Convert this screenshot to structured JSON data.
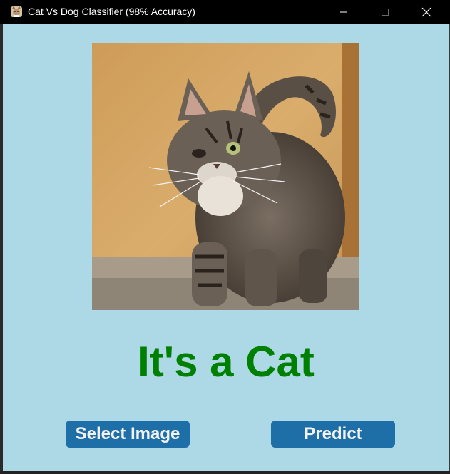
{
  "window": {
    "title": "Cat Vs Dog Classifier (98% Accuracy)",
    "app_icon": "cat-app-icon",
    "controls": [
      "minimize-icon",
      "maximize-icon",
      "close-icon"
    ]
  },
  "main": {
    "image_alt": "cat-photo",
    "result_text": "It's a Cat",
    "result_color": "#008000",
    "background_color": "#add8e6"
  },
  "buttons": {
    "select_label": "Select Image",
    "predict_label": "Predict",
    "button_color": "#1e6ea7"
  }
}
